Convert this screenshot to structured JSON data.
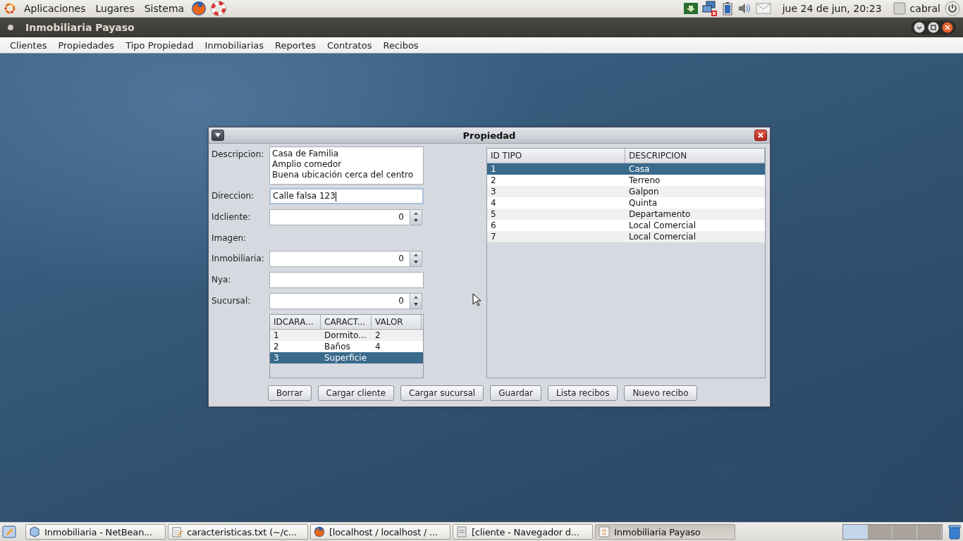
{
  "top_panel": {
    "menus": [
      "Aplicaciones",
      "Lugares",
      "Sistema"
    ],
    "clock": "jue 24 de jun, 20:23",
    "user": "cabral"
  },
  "app_window": {
    "title": "Inmobiliaria Payaso",
    "menu": [
      "Clientes",
      "Propiedades",
      "Tipo Propiedad",
      "Inmobiliarias",
      "Reportes",
      "Contratos",
      "Recibos"
    ]
  },
  "dialog": {
    "title": "Propiedad",
    "fields": [
      {
        "kind": "textarea",
        "label": "Descripcion:",
        "lines": [
          "Casa de Familia",
          "Amplio comedor",
          "Buena ubicación cerca del centro"
        ]
      },
      {
        "kind": "text",
        "label": "Direccion:",
        "value": "Calle falsa 123",
        "focused": true
      },
      {
        "kind": "spinner",
        "label": "Idcliente:",
        "value": "0"
      },
      {
        "kind": "label",
        "label": "Imagen:"
      },
      {
        "kind": "spinner",
        "label": "Inmobiliaria:",
        "value": "0"
      },
      {
        "kind": "text",
        "label": "Nya:",
        "focused": false
      },
      {
        "kind": "spinner",
        "label": "Sucursal:",
        "value": "0"
      }
    ],
    "features_table": {
      "columns": [
        "IDCARA...",
        "CARACT...",
        "VALOR"
      ],
      "rows": [
        {
          "cells": [
            "1",
            "Dormito...",
            "2"
          ],
          "selected": false
        },
        {
          "cells": [
            "2",
            "Baños",
            "4"
          ],
          "selected": false
        },
        {
          "cells": [
            "3",
            "Superficie"
          ],
          "selected": true
        }
      ]
    },
    "types_table": {
      "columns": [
        "ID TIPO",
        "DESCRIPCION"
      ],
      "rows": [
        {
          "cells": [
            "1",
            "Casa"
          ],
          "selected": true
        },
        {
          "cells": [
            "2",
            "Terreno"
          ],
          "selected": false
        },
        {
          "cells": [
            "3",
            "Galpon"
          ],
          "selected": false
        },
        {
          "cells": [
            "4",
            "Quinta"
          ],
          "selected": false
        },
        {
          "cells": [
            "5",
            "Departamento"
          ],
          "selected": false
        },
        {
          "cells": [
            "6",
            "Local Comercial"
          ],
          "selected": false
        },
        {
          "cells": [
            "7",
            "Local Comercial"
          ],
          "selected": false
        }
      ]
    },
    "buttons": [
      "Borrar",
      "Cargar cliente",
      "Cargar sucursal",
      "Guardar",
      "Lista recibos",
      "Nuevo recibo"
    ]
  },
  "taskbar": {
    "items": [
      {
        "label": "Inmobiliaria - NetBean...",
        "kind": "netbeans",
        "selected": false
      },
      {
        "label": "caracteristicas.txt (~/c...",
        "kind": "editor",
        "selected": false
      },
      {
        "label": "[localhost / localhost / ...",
        "kind": "browser",
        "selected": false
      },
      {
        "label": "[cliente - Navegador d...",
        "kind": "window",
        "selected": false
      },
      {
        "label": "Inmobiliaria Payaso",
        "kind": "java",
        "selected": true
      }
    ],
    "workspaces": [
      {
        "selected": true
      },
      {
        "selected": false
      },
      {
        "selected": false
      },
      {
        "selected": false
      }
    ]
  }
}
